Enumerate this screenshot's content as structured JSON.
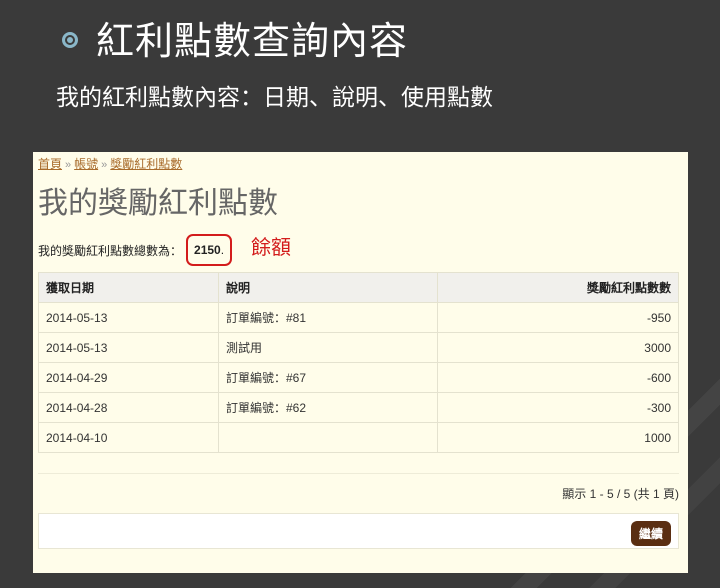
{
  "slide": {
    "title": "紅利點數查詢內容",
    "subtitle": "我的紅利點數內容：日期、說明、使用點數"
  },
  "webpage": {
    "breadcrumb": [
      "首頁",
      "帳號",
      "獎勵紅利點數"
    ],
    "breadcrumb_sep": "»",
    "heading": "我的獎勵紅利點數",
    "total_label": "我的獎勵紅利點數總數為：",
    "total_value": "2150",
    "total_suffix": ".",
    "balance_annotation": "餘額",
    "table": {
      "headers": [
        "獲取日期",
        "說明",
        "獎勵紅利點數數"
      ],
      "rows": [
        [
          "2014-05-13",
          "訂單編號：#81",
          "-950"
        ],
        [
          "2014-05-13",
          "測試用",
          "3000"
        ],
        [
          "2014-04-29",
          "訂單編號：#67",
          "-600"
        ],
        [
          "2014-04-28",
          "訂單編號：#62",
          "-300"
        ],
        [
          "2014-04-10",
          "",
          "1000"
        ]
      ]
    },
    "pagination": "顯示 1 - 5 / 5 (共 1 頁)",
    "continue_label": "繼續"
  },
  "colors": {
    "slide_bg": "#3a3a3a",
    "panel_bg": "#fffdea",
    "highlight_red": "#d31c1c",
    "button_bg": "#5a2e12"
  }
}
